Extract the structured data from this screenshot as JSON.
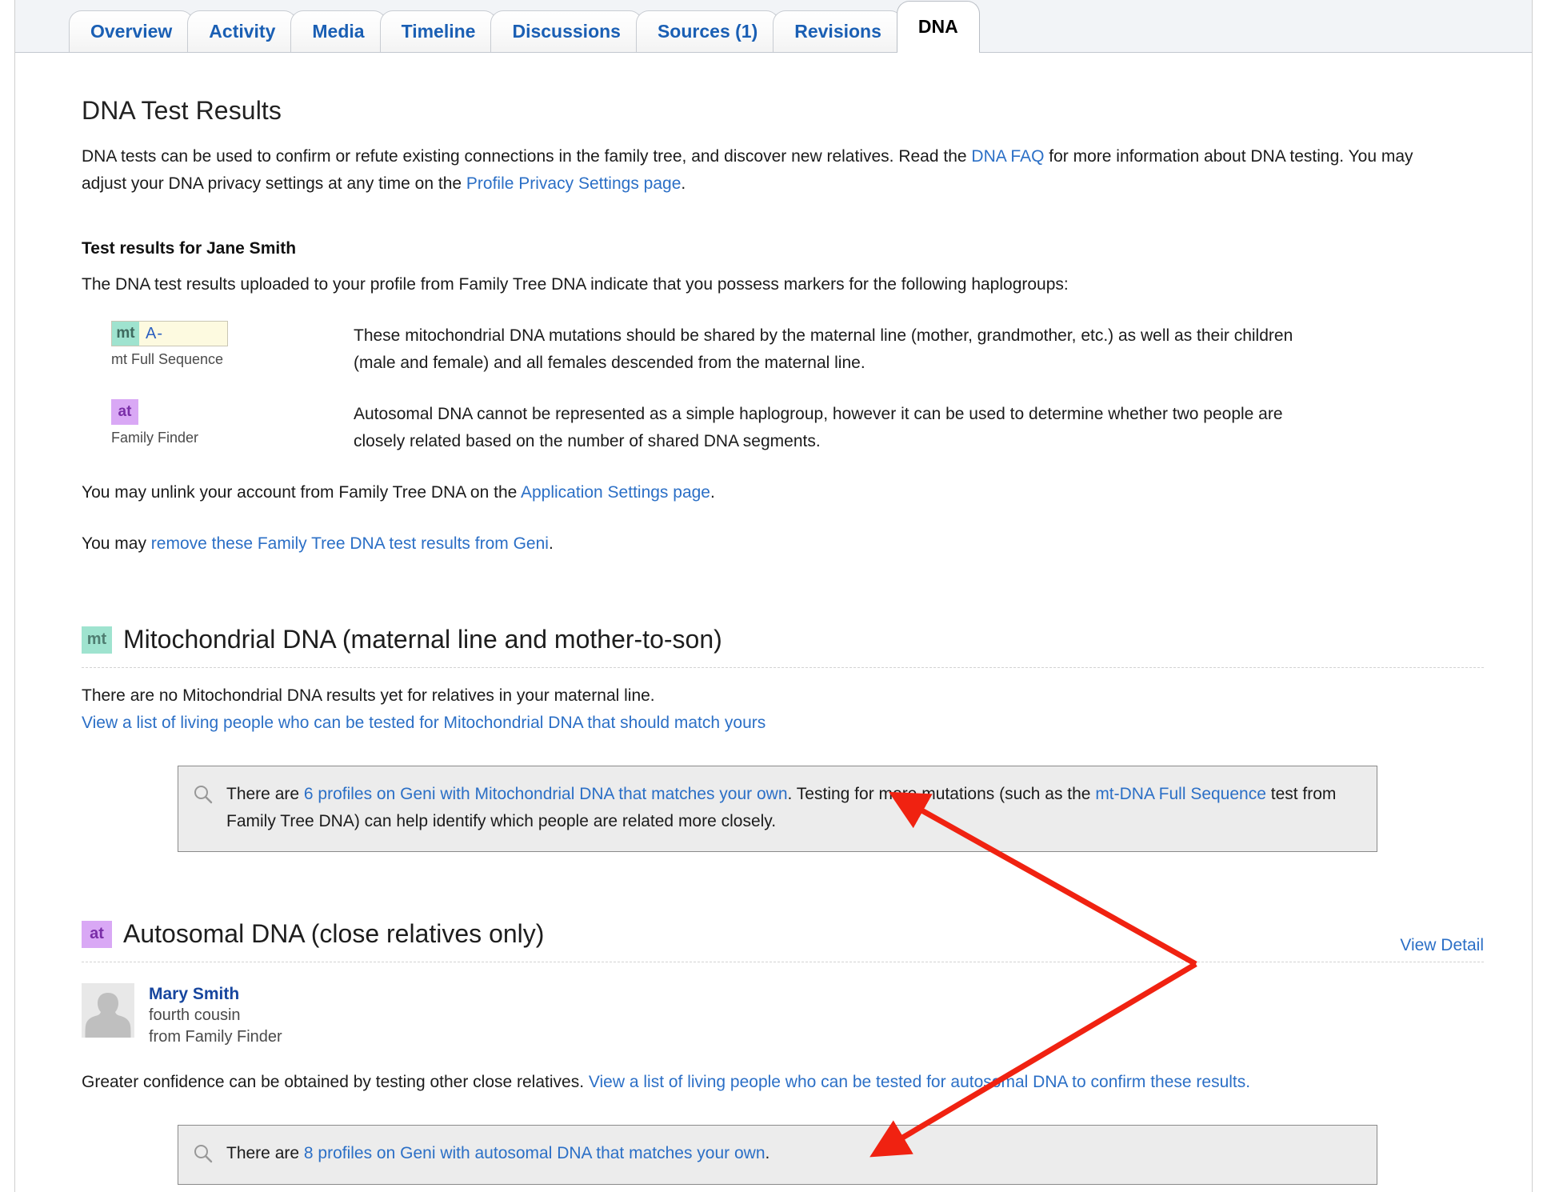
{
  "tabs": [
    {
      "label": "Overview",
      "active": false
    },
    {
      "label": "Activity",
      "active": false
    },
    {
      "label": "Media",
      "active": false
    },
    {
      "label": "Timeline",
      "active": false
    },
    {
      "label": "Discussions",
      "active": false
    },
    {
      "label": "Sources (1)",
      "active": false
    },
    {
      "label": "Revisions",
      "active": false
    },
    {
      "label": "DNA",
      "active": true
    }
  ],
  "page": {
    "title": "DNA Test Results",
    "intro_1": "DNA tests can be used to confirm or refute existing connections in the family tree, and discover new relatives. Read the ",
    "intro_link_1": "DNA FAQ",
    "intro_2": " for more information about DNA testing. You may adjust your DNA privacy settings at any time on the ",
    "intro_link_2": "Profile Privacy Settings page",
    "intro_3": "."
  },
  "results": {
    "subhead_prefix": "Test results for ",
    "subject_name": "Jane Smith",
    "sub_intro": "The DNA test results uploaded to your profile from Family Tree DNA indicate that you possess markers for the following haplogroups:",
    "haplogroups": [
      {
        "chip": "mt",
        "chip_kind": "mt",
        "value": "A-",
        "caption": "mt Full Sequence",
        "description": "These mitochondrial DNA mutations should be shared by the maternal line (mother, grandmother, etc.) as well as their children (male and female) and all females descended from the maternal line."
      },
      {
        "chip": "at",
        "chip_kind": "at",
        "value": "",
        "caption": "Family Finder",
        "description": "Autosomal DNA cannot be represented as a simple haplogroup, however it can be used to determine whether two people are closely related based on the number of shared DNA segments."
      }
    ],
    "unlink_1": "You may unlink your account from Family Tree DNA on the ",
    "unlink_link": "Application Settings page",
    "unlink_2": ".",
    "remove_1": "You may ",
    "remove_link": "remove these Family Tree DNA test results from Geni",
    "remove_2": "."
  },
  "mito": {
    "chip": "mt",
    "title": "Mitochondrial DNA (maternal line and mother-to-son)",
    "no_results": "There are no Mitochondrial DNA results yet for relatives in your maternal line.",
    "view_list_link": "View a list of living people who can be tested for Mitochondrial DNA that should match yours",
    "info_1": "There are ",
    "info_link_1": "6 profiles on Geni with Mitochondrial DNA that matches your own",
    "info_2": ". Testing for more mutations (such as the ",
    "info_link_2": "mt-DNA Full Sequence",
    "info_3": " test from Family Tree DNA) can help identify which people are related more closely."
  },
  "autosomal": {
    "chip": "at",
    "title": "Autosomal DNA (close relatives only)",
    "view_detail": "View Detail",
    "match": {
      "name": "Mary Smith",
      "relationship": "fourth cousin",
      "source": "from Family Finder"
    },
    "confidence_1": "Greater confidence can be obtained by testing other close relatives. ",
    "confidence_link": "View a list of living people who can be tested for autosomal DNA to confirm these results.",
    "info_1": "There are ",
    "info_link_1": "8 profiles on Geni with autosomal DNA that matches your own",
    "info_2": "."
  },
  "icons": {
    "magnifier": "search-icon",
    "avatar": "person-avatar-icon"
  },
  "colors": {
    "link": "#2b6fc6",
    "tab_link": "#1a5fb4",
    "mt_chip_bg": "#9fe3cf",
    "at_chip_bg": "#d9a8f5",
    "haplo_value_bg": "#fdfae0",
    "info_box_bg": "#ececec",
    "annotation_arrow": "#f02211"
  }
}
